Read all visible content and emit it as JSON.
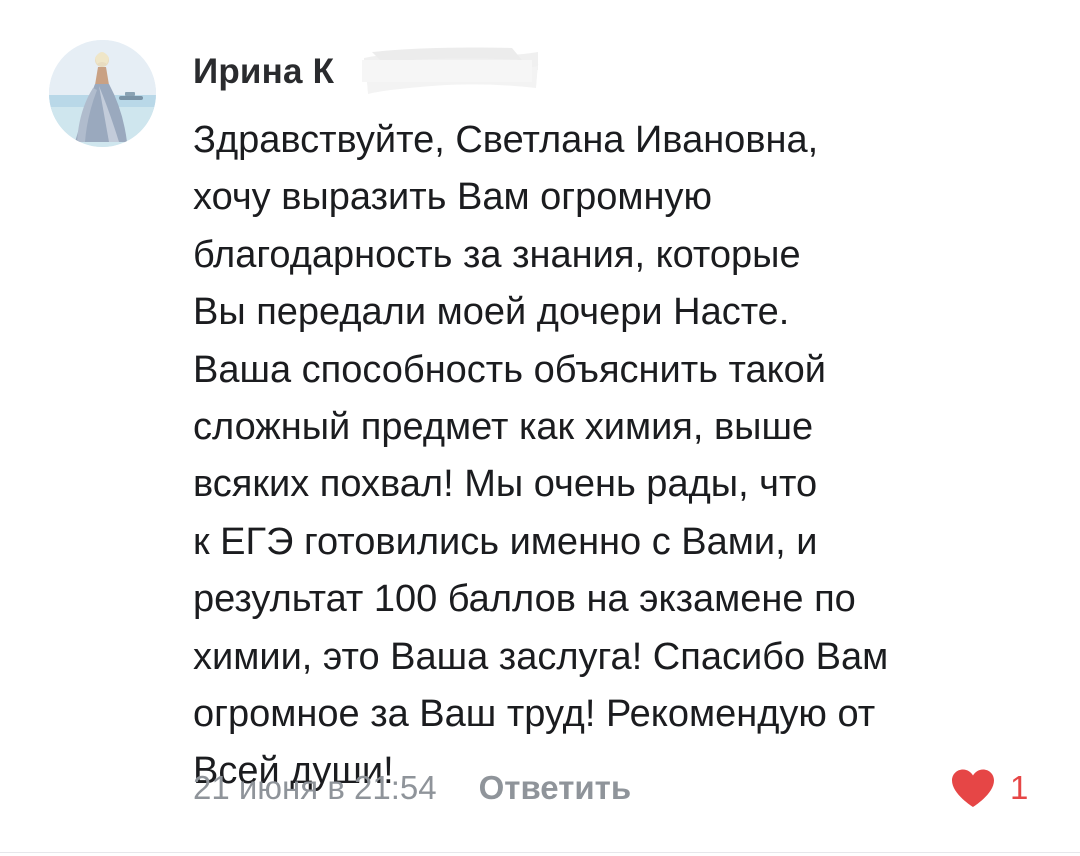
{
  "comment": {
    "author_visible": "Ирина К",
    "text": "Здравствуйте, Светлана Ивановна,\nхочу выразить Вам огромную\nблагодарность за знания, которые\nВы передали моей дочери Насте.\nВаша способность объяснить такой\nсложный предмет как химия, выше\nвсяких похвал! Мы очень рады, что\nк ЕГЭ готовились именно с Вами, и\nрезультат 100 баллов на экзамене по\nхимии, это Ваша заслуга! Спасибо Вам\nогромное за Ваш труд! Рекомендую от\nВсей души!",
    "date": "21 июня в 21:54",
    "reply_label": "Ответить",
    "likes": "1"
  },
  "colors": {
    "like_red": "#e64646",
    "meta_gray": "#8f949a",
    "text": "#1b1c1f"
  },
  "icons": {
    "like": "heart-icon"
  }
}
